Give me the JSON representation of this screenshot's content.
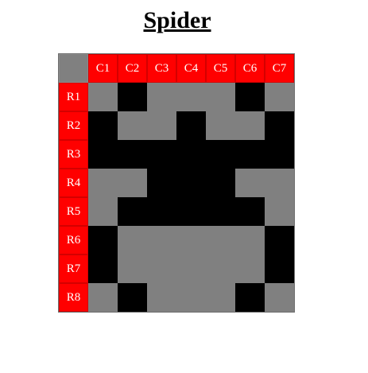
{
  "page": {
    "title": "Spider"
  },
  "colors": {
    "header": "#ff0000",
    "filled": "#000000",
    "empty": "#808080",
    "header_text": "#ffffff"
  },
  "grid": {
    "columns": [
      "C1",
      "C2",
      "C3",
      "C4",
      "C5",
      "C6",
      "C7"
    ],
    "rows": [
      {
        "label": "R1",
        "cells": [
          0,
          1,
          0,
          0,
          0,
          1,
          0
        ]
      },
      {
        "label": "R2",
        "cells": [
          1,
          0,
          0,
          1,
          0,
          0,
          1
        ]
      },
      {
        "label": "R3",
        "cells": [
          1,
          1,
          1,
          1,
          1,
          1,
          1
        ]
      },
      {
        "label": "R4",
        "cells": [
          0,
          0,
          1,
          1,
          1,
          0,
          0
        ]
      },
      {
        "label": "R5",
        "cells": [
          0,
          1,
          1,
          1,
          1,
          1,
          0
        ]
      },
      {
        "label": "R6",
        "cells": [
          1,
          0,
          0,
          0,
          0,
          0,
          1
        ]
      },
      {
        "label": "R7",
        "cells": [
          1,
          0,
          0,
          0,
          0,
          0,
          1
        ]
      },
      {
        "label": "R8",
        "cells": [
          0,
          1,
          0,
          0,
          0,
          1,
          0
        ]
      }
    ]
  }
}
